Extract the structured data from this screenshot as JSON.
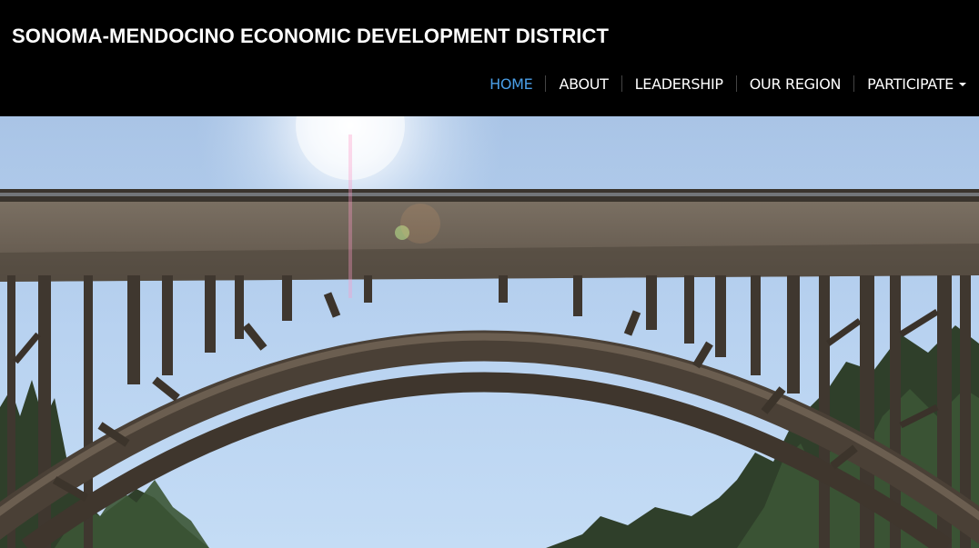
{
  "header": {
    "site_title": "SONOMA-MENDOCINO ECONOMIC DEVELOPMENT DISTRICT"
  },
  "nav": {
    "items": [
      {
        "label": "HOME",
        "active": true
      },
      {
        "label": "ABOUT",
        "active": false
      },
      {
        "label": "LEADERSHIP",
        "active": false
      },
      {
        "label": "OUR REGION",
        "active": false
      },
      {
        "label": "PARTICIPATE",
        "active": false,
        "dropdown": true
      }
    ]
  },
  "colors": {
    "header_bg": "#000000",
    "nav_active": "#4a9fe8",
    "nav_text": "#ffffff"
  },
  "hero": {
    "icon": "bridge-photo"
  }
}
